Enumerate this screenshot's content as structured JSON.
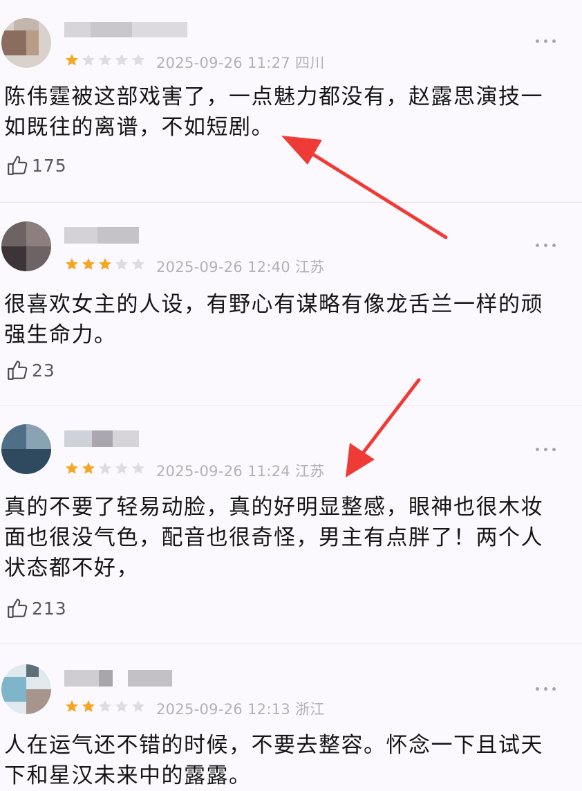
{
  "reviews": [
    {
      "rating": 1,
      "timestamp": "2025-09-26 11:27",
      "location": "四川",
      "text_lines": [
        "陈伟霆被这部戏害了，一点魅力都没有，赵露思演技一",
        "如既往的离谱，不如短剧。"
      ],
      "likes": "175"
    },
    {
      "rating": 3,
      "timestamp": "2025-09-26 12:40",
      "location": "江苏",
      "text_lines": [
        "很喜欢女主的人设，有野心有谋略有像龙舌兰一样的顽",
        "强生命力。"
      ],
      "likes": "23"
    },
    {
      "rating": 2,
      "timestamp": "2025-09-26 11:24",
      "location": "江苏",
      "text_lines": [
        "真的不要了轻易动脸，真的好明显整感，眼神也很木妆",
        "面也很没气色，配音也很奇怪，男主有点胖了！两个人",
        "状态都不好，"
      ],
      "likes": "213"
    },
    {
      "rating": 2,
      "timestamp": "2025-09-26 12:13",
      "location": "浙江",
      "text_lines": [
        "人在运气还不错的时候，不要去整容。怀念一下且试天",
        "下和星汉未来中的露露。"
      ],
      "likes": ""
    }
  ],
  "colors": {
    "star_filled": "#f5a623",
    "star_empty": "#dedbe2",
    "arrow": "#ee3b36"
  },
  "icons": {
    "like": "thumbs-up-icon",
    "more": "more-dots-icon",
    "star": "star-icon"
  }
}
